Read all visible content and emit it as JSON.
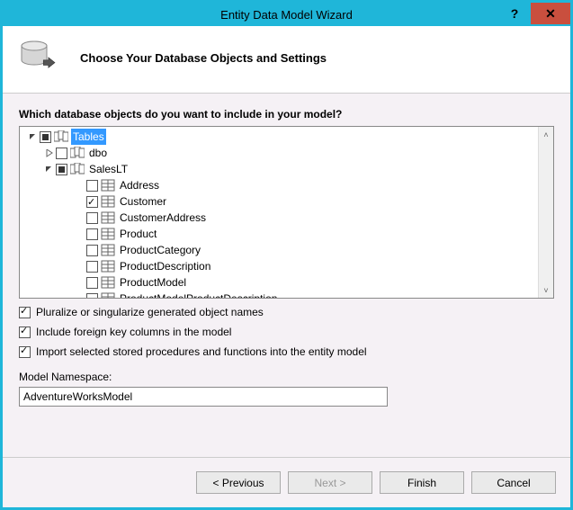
{
  "window": {
    "title": "Entity Data Model Wizard"
  },
  "header": {
    "text": "Choose Your Database Objects and Settings"
  },
  "prompt": "Which database objects do you want to include in your model?",
  "tree": {
    "root": {
      "label": "Tables"
    },
    "dbo": {
      "label": "dbo"
    },
    "saleslt": {
      "label": "SalesLT"
    },
    "items": {
      "address": "Address",
      "customer": "Customer",
      "customerAddress": "CustomerAddress",
      "product": "Product",
      "productCategory": "ProductCategory",
      "productDescription": "ProductDescription",
      "productModel": "ProductModel",
      "productModelProductDescription": "ProductModelProductDescription"
    }
  },
  "options": {
    "pluralize": "Pluralize or singularize generated object names",
    "fk": "Include foreign key columns in the model",
    "sp": "Import selected stored procedures and functions into the entity model"
  },
  "namespace": {
    "label": "Model Namespace:",
    "value": "AdventureWorksModel"
  },
  "buttons": {
    "previous": "< Previous",
    "next": "Next >",
    "finish": "Finish",
    "cancel": "Cancel"
  }
}
